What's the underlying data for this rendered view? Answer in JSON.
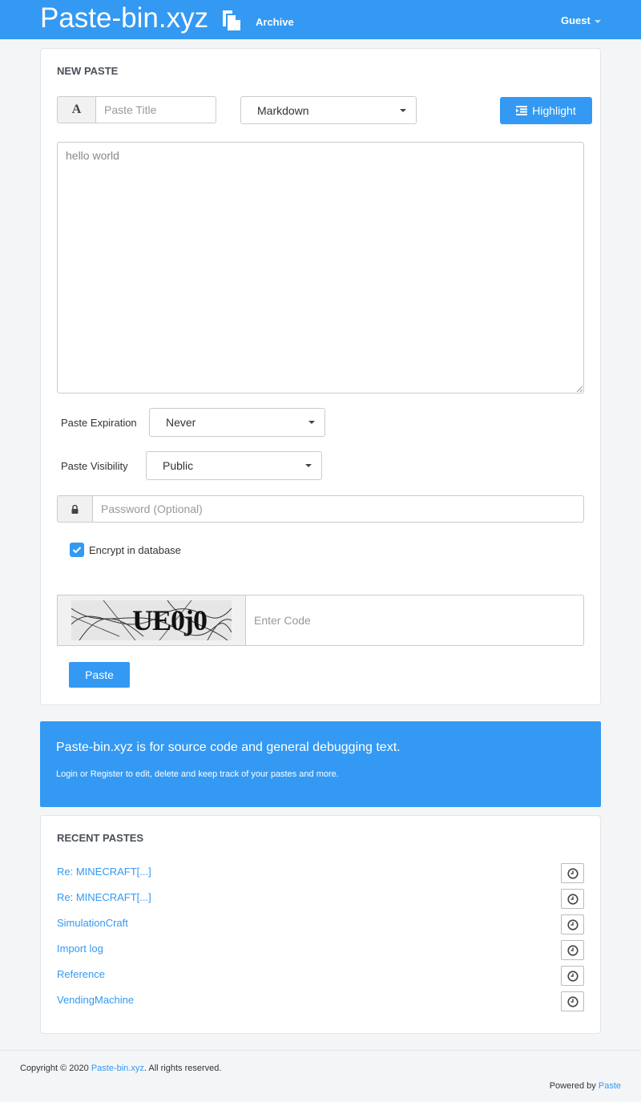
{
  "navbar": {
    "brand": "Paste-bin.xyz",
    "brand_icon": "clipboard-icon",
    "archive_label": "Archive",
    "guest_label": "Guest"
  },
  "new_paste": {
    "heading": "NEW PASTE",
    "title_icon": "font-icon",
    "title_placeholder": "Paste Title",
    "syntax_selected": "Markdown",
    "highlight_icon": "indent-icon",
    "highlight_label": "Highlight",
    "content": "hello world",
    "expiration_label": "Paste Expiration",
    "expiration_selected": "Never",
    "visibility_label": "Paste Visibility",
    "visibility_selected": "Public",
    "password_icon": "lock-icon",
    "password_placeholder": "Password (Optional)",
    "encrypt_label": "Encrypt in database",
    "encrypt_checked": true,
    "captcha_text": "UE0j0",
    "captcha_placeholder": "Enter Code",
    "submit_label": "Paste"
  },
  "info": {
    "headline": "Paste-bin.xyz is for source code and general debugging text.",
    "subtext": "Login or Register to edit, delete and keep track of your pastes and more."
  },
  "recent": {
    "heading": "RECENT PASTES",
    "items": [
      {
        "title": "Re: MINECRAFT[...]",
        "icon": "clock-icon"
      },
      {
        "title": "Re: MINECRAFT[...]",
        "icon": "clock-icon"
      },
      {
        "title": "SimulationCraft",
        "icon": "clock-icon"
      },
      {
        "title": "Import log",
        "icon": "clock-icon"
      },
      {
        "title": "Reference",
        "icon": "clock-icon"
      },
      {
        "title": "VendingMachine",
        "icon": "clock-icon"
      }
    ]
  },
  "footer": {
    "copyright_prefix": "Copyright © 2020 ",
    "copyright_link": "Paste-bin.xyz",
    "copyright_suffix": ". All rights reserved.",
    "powered_prefix": "Powered by ",
    "powered_link": "Paste"
  },
  "colors": {
    "accent": "#3399f3",
    "background": "#f4f5f7"
  }
}
